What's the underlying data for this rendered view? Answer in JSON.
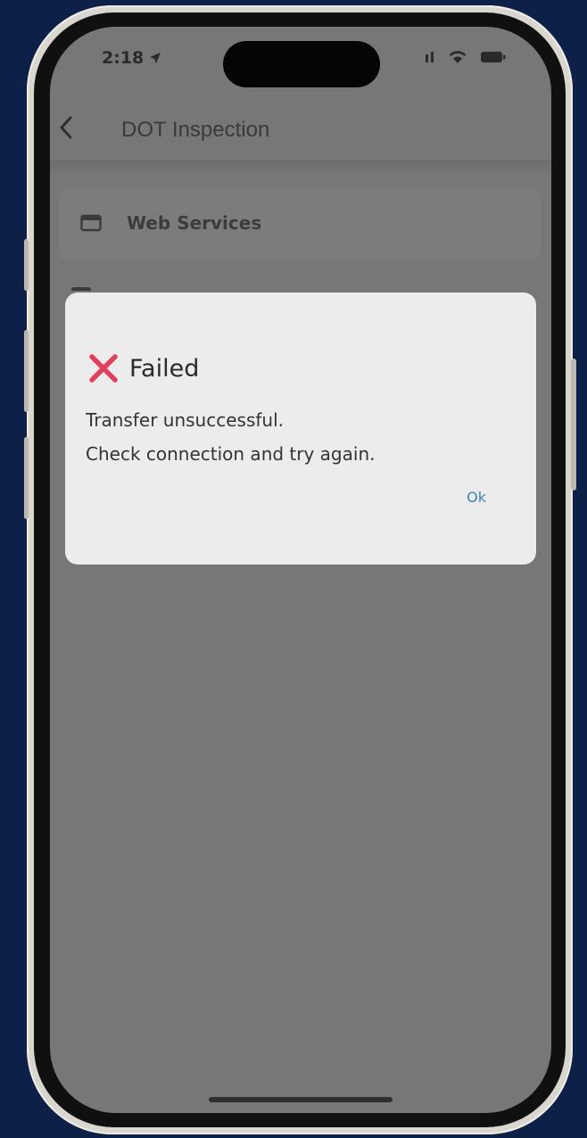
{
  "status_bar": {
    "time": "2:18",
    "icons": [
      "location-arrow-icon",
      "sim-icon",
      "wifi-icon",
      "battery-icon"
    ]
  },
  "header": {
    "back_icon": "chevron-left-icon",
    "title": "DOT Inspection"
  },
  "menu": {
    "items": [
      {
        "icon": "calendar-icon",
        "label": "Web Services"
      }
    ]
  },
  "dialog": {
    "icon": "x-mark-icon",
    "title": "Failed",
    "message_line1": "Transfer unsuccessful.",
    "message_line2": "Check connection and try again.",
    "ok_label": "Ok"
  },
  "colors": {
    "background": "#0d2148",
    "error_icon": "#e0405a",
    "ok_button": "#3e85a8",
    "dialog": "#ececec",
    "overlay": "#777777"
  }
}
